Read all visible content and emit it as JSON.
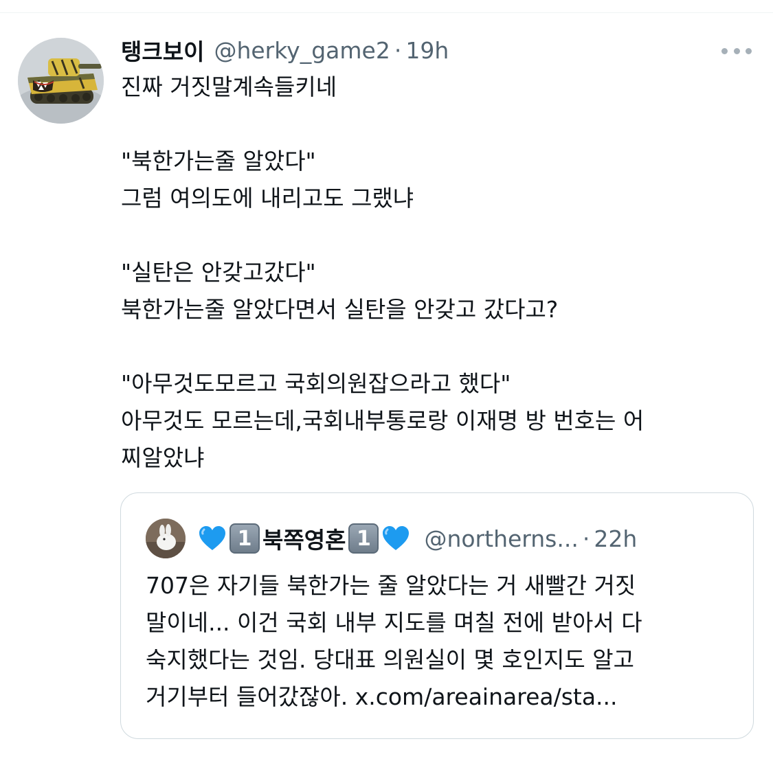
{
  "tweet": {
    "avatar_icon": "tank-model-avatar",
    "display_name": "탱크보이",
    "handle": "@herky_game2",
    "separator": "·",
    "time": "19h",
    "more_icon": "more-horizontal-icon",
    "lines": [
      "진짜 거짓말계속들키네",
      "",
      "\"북한가는줄 알았다\"",
      "그럼 여의도에 내리고도 그랬냐",
      "",
      "\"실탄은 안갖고갔다\"",
      "북한가는줄 알았다면서 실탄을 안갖고 갔다고?",
      "",
      "\"아무것도모르고 국회의원잡으라고 했다\"",
      "아무것도 모르는데,국회내부통로랑 이재명 방 번호는 어",
      "찌알았냐"
    ]
  },
  "quote": {
    "avatar_icon": "rabbit-photo-avatar",
    "name_emoji_heart": "blue-heart-icon",
    "name_keycap": "1",
    "display_name": "북쪽영혼",
    "handle": "@northerns...",
    "separator": "·",
    "time": "22h",
    "lines": [
      "707은 자기들 북한가는 줄 알았다는 거 새빨간 거짓",
      "말이네... 이건 국회 내부 지도를 며칠 전에 받아서 다",
      "숙지했다는 것임. 당대표 의원실이 몇 호인지도 알고",
      "거기부터 들어갔잖아. x.com/areainarea/sta..."
    ]
  },
  "colors": {
    "text": "#0f1419",
    "secondary": "#536471",
    "border": "#cfd9de",
    "heart": "#1d9bf0"
  }
}
